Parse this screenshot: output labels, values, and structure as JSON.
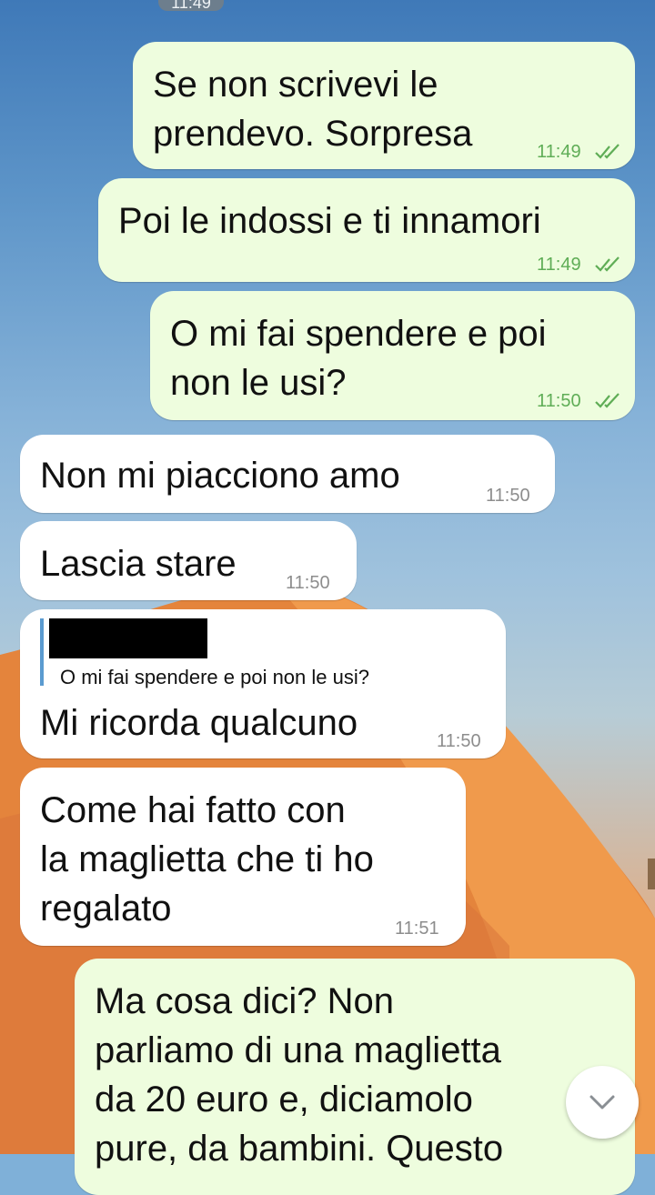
{
  "status": {
    "time_pill": "11:49"
  },
  "messages": [
    {
      "id": "m1",
      "text": "Se non scrivevi le\nprendevo. Sorpresa",
      "time": "11:49",
      "direction": "out"
    },
    {
      "id": "m2",
      "text": "Poi le indossi e ti innamori",
      "time": "11:49",
      "direction": "out"
    },
    {
      "id": "m3",
      "text": "O mi fai spendere e poi\nnon le usi?",
      "time": "11:50",
      "direction": "out"
    },
    {
      "id": "m4",
      "text": "Non mi piacciono amo",
      "time": "11:50",
      "direction": "in"
    },
    {
      "id": "m5",
      "text": "Lascia stare",
      "time": "11:50",
      "direction": "in"
    },
    {
      "id": "m6",
      "quote": "O mi fai spendere e poi non le usi?",
      "text": "Mi ricorda qualcuno",
      "time": "11:50",
      "direction": "in"
    },
    {
      "id": "m7",
      "text": "Come hai fatto con\nla maglietta che ti ho\nregalato",
      "time": "11:51",
      "direction": "in"
    },
    {
      "id": "m8",
      "text": "Ma cosa dici? Non\nparliamo di una maglietta\nda 20 euro e, diciamolo\npure, da bambini. Questo",
      "direction": "out"
    }
  ],
  "controls": {
    "scroll_down_icon": "chevron-down-icon"
  },
  "colors": {
    "outgoing_bubble": "#eefdde",
    "incoming_bubble": "#ffffff",
    "read_ticks": "#5fad56"
  }
}
